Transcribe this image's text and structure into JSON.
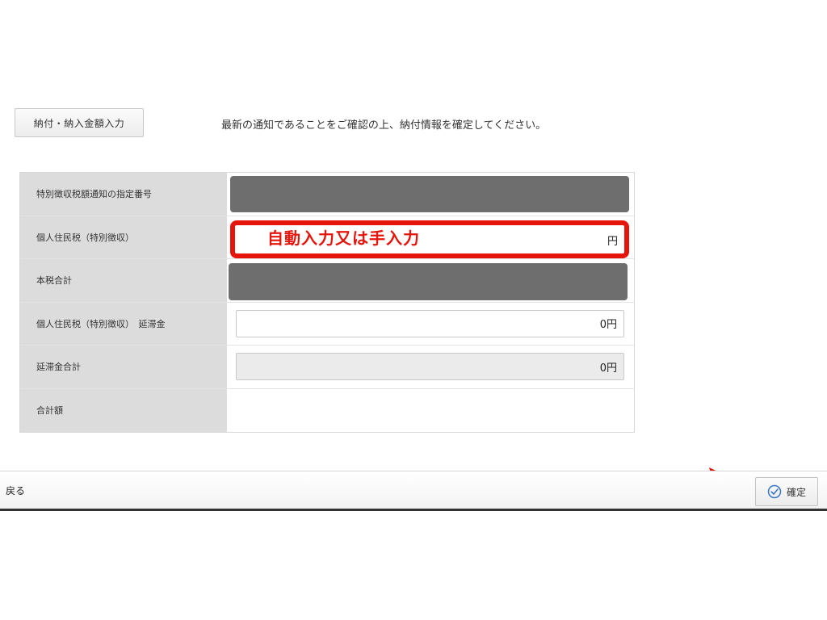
{
  "header": {
    "section_button_label": "納付・納入金額入力",
    "notice": "最新の通知であることをご確認の上、納付情報を確定してください。"
  },
  "form": {
    "rows": [
      {
        "label": "特別徴収税額通知の指定番号",
        "value": ""
      },
      {
        "label": "個人住民税（特別徴収）",
        "value": "円",
        "annotation": "自動入力又は手入力"
      },
      {
        "label": "本税合計",
        "value": ""
      },
      {
        "label": "個人住民税（特別徴収）　延滞金",
        "value": "0円"
      },
      {
        "label": "延滞金合計",
        "value": "0円"
      },
      {
        "label": "合計額",
        "value": ""
      }
    ]
  },
  "footer": {
    "back_label": "戻る",
    "confirm_label": "確定"
  },
  "colors": {
    "annotation_red": "#e5150c",
    "label_bg": "#dcdcdc",
    "masked": "#6e6e6e"
  },
  "icons": {
    "confirm": "check-circle-icon",
    "pointer": "arrow-right-icon"
  }
}
